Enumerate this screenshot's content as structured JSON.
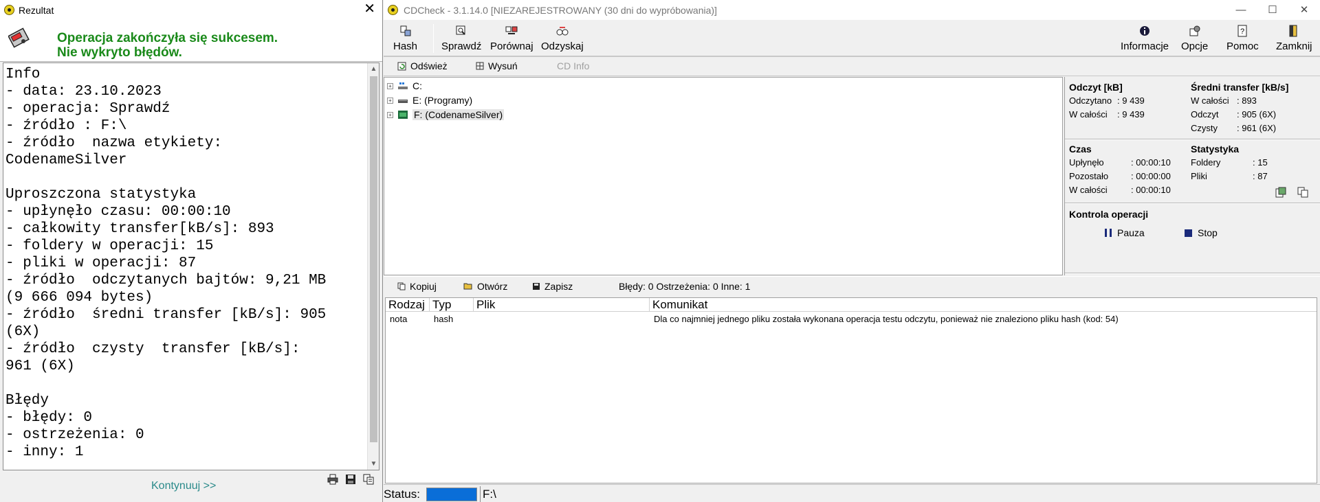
{
  "result_window": {
    "title": "Rezultat",
    "message_line1": "Operacja zakończyła się sukcesem.",
    "message_line2": "Nie wykryto błędów.",
    "report_text": "Info\n- data: 23.10.2023\n- operacja: Sprawdź\n- źródło : F:\\\n- źródło  nazwa etykiety:\nCodenameSilver\n\nUproszczona statystyka\n- upłynęło czasu: 00:00:10\n- całkowity transfer[kB/s]: 893\n- foldery w operacji: 15\n- pliki w operacji: 87\n- źródło  odczytanych bajtów: 9,21 MB\n(9 666 094 bytes)\n- źródło  średni transfer [kB/s]: 905\n(6X)\n- źródło  czysty  transfer [kB/s]:\n961 (6X)\n\nBłędy\n- błędy: 0\n- ostrzeżenia: 0\n- inny: 1",
    "continue_label": "Kontynuuj >>",
    "close_glyph": "✕"
  },
  "cd_window": {
    "title": "CDCheck - 3.1.14.0 [NIEZAREJESTROWANY (30 dni do wypróbowania)]",
    "win_controls": [
      "—",
      "☐",
      "✕"
    ],
    "toolbar_left": [
      "Hash",
      "Sprawdź",
      "Porównaj",
      "Odzyskaj"
    ],
    "toolbar_right": [
      "Informacje",
      "Opcje",
      "Pomoc",
      "Zamknij"
    ],
    "subbar": {
      "refresh": "Odśwież",
      "eject": "Wysuń",
      "cdinfo": "CD Info"
    },
    "tree": [
      "C:",
      "E: (Programy)",
      "F: (CodenameSilver)"
    ],
    "stats": {
      "read_header": "Odczyt [kB]",
      "read_rows": [
        [
          "Odczytano",
          ": 9 439"
        ],
        [
          "W całości",
          ": 9 439"
        ]
      ],
      "transfer_header": "Średni transfer [kB/s]",
      "transfer_rows": [
        [
          "W całości",
          ": 893"
        ],
        [
          "Odczyt",
          ": 905 (6X)"
        ],
        [
          "Czysty",
          ": 961 (6X)"
        ]
      ],
      "time_header": "Czas",
      "time_rows": [
        [
          "Upłynęło",
          ": 00:00:10"
        ],
        [
          "Pozostało",
          ": 00:00:00"
        ],
        [
          "W całości",
          ": 00:00:10"
        ]
      ],
      "stat_header": "Statystyka",
      "stat_rows": [
        [
          "Foldery",
          ": 15"
        ],
        [
          "Pliki",
          ": 87"
        ]
      ],
      "control_header": "Kontrola operacji",
      "pause_label": "Pauza",
      "stop_label": "Stop"
    },
    "midbar": {
      "copy": "Kopiuj",
      "open": "Otwórz",
      "save": "Zapisz",
      "summary": "Błędy: 0  Ostrzeżenia: 0  Inne: 1"
    },
    "grid": {
      "columns": [
        "Rodzaj",
        "Typ",
        "Plik",
        "Komunikat"
      ],
      "rows": [
        {
          "kind": "nota",
          "type": "hash",
          "file": "",
          "message": "Dla co najmniej jednego pliku została wykonana operacja testu odczytu, ponieważ nie znaleziono pliku hash (kod: 54)"
        }
      ]
    },
    "status": {
      "label": "Status:",
      "progress_fraction": 1.0,
      "path": "F:\\"
    }
  },
  "colors": {
    "success_green": "#1a8a1a",
    "accent_blue": "#0a6ed8",
    "control_navy": "#1a2a7a"
  }
}
